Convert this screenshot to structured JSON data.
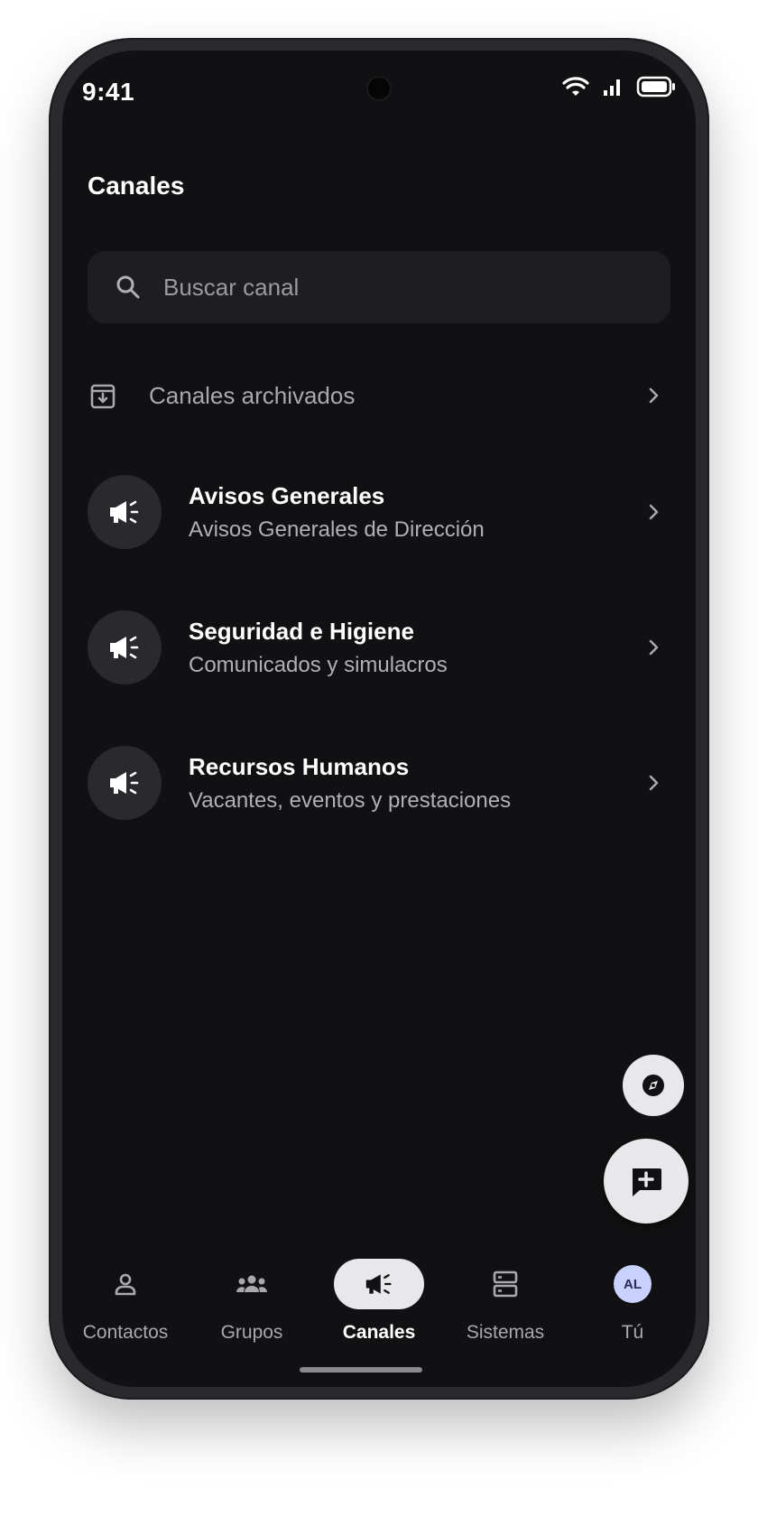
{
  "status": {
    "time": "9:41"
  },
  "header": {
    "title": "Canales"
  },
  "search": {
    "placeholder": "Buscar canal",
    "icon": "search-icon"
  },
  "archived": {
    "label": "Canales archivados",
    "icon": "archive-icon"
  },
  "channels": [
    {
      "name": "Avisos Generales",
      "description": "Avisos Generales de Dirección",
      "icon": "megaphone-icon"
    },
    {
      "name": "Seguridad e Higiene",
      "description": "Comunicados y simulacros",
      "icon": "megaphone-icon"
    },
    {
      "name": "Recursos Humanos",
      "description": "Vacantes, eventos y prestaciones",
      "icon": "megaphone-icon"
    }
  ],
  "fabs": {
    "explore_icon": "compass-icon",
    "new_icon": "add-comment-icon"
  },
  "nav": {
    "items": [
      {
        "label": "Contactos",
        "icon": "person-icon"
      },
      {
        "label": "Grupos",
        "icon": "groups-icon"
      },
      {
        "label": "Canales",
        "icon": "megaphone-icon",
        "active": true
      },
      {
        "label": "Sistemas",
        "icon": "server-icon"
      },
      {
        "label": "Tú",
        "avatar_initials": "AL"
      }
    ]
  },
  "colors": {
    "background": "#111113",
    "surface": "#1e1e21",
    "accent_avatar": "#c9d2ff"
  }
}
